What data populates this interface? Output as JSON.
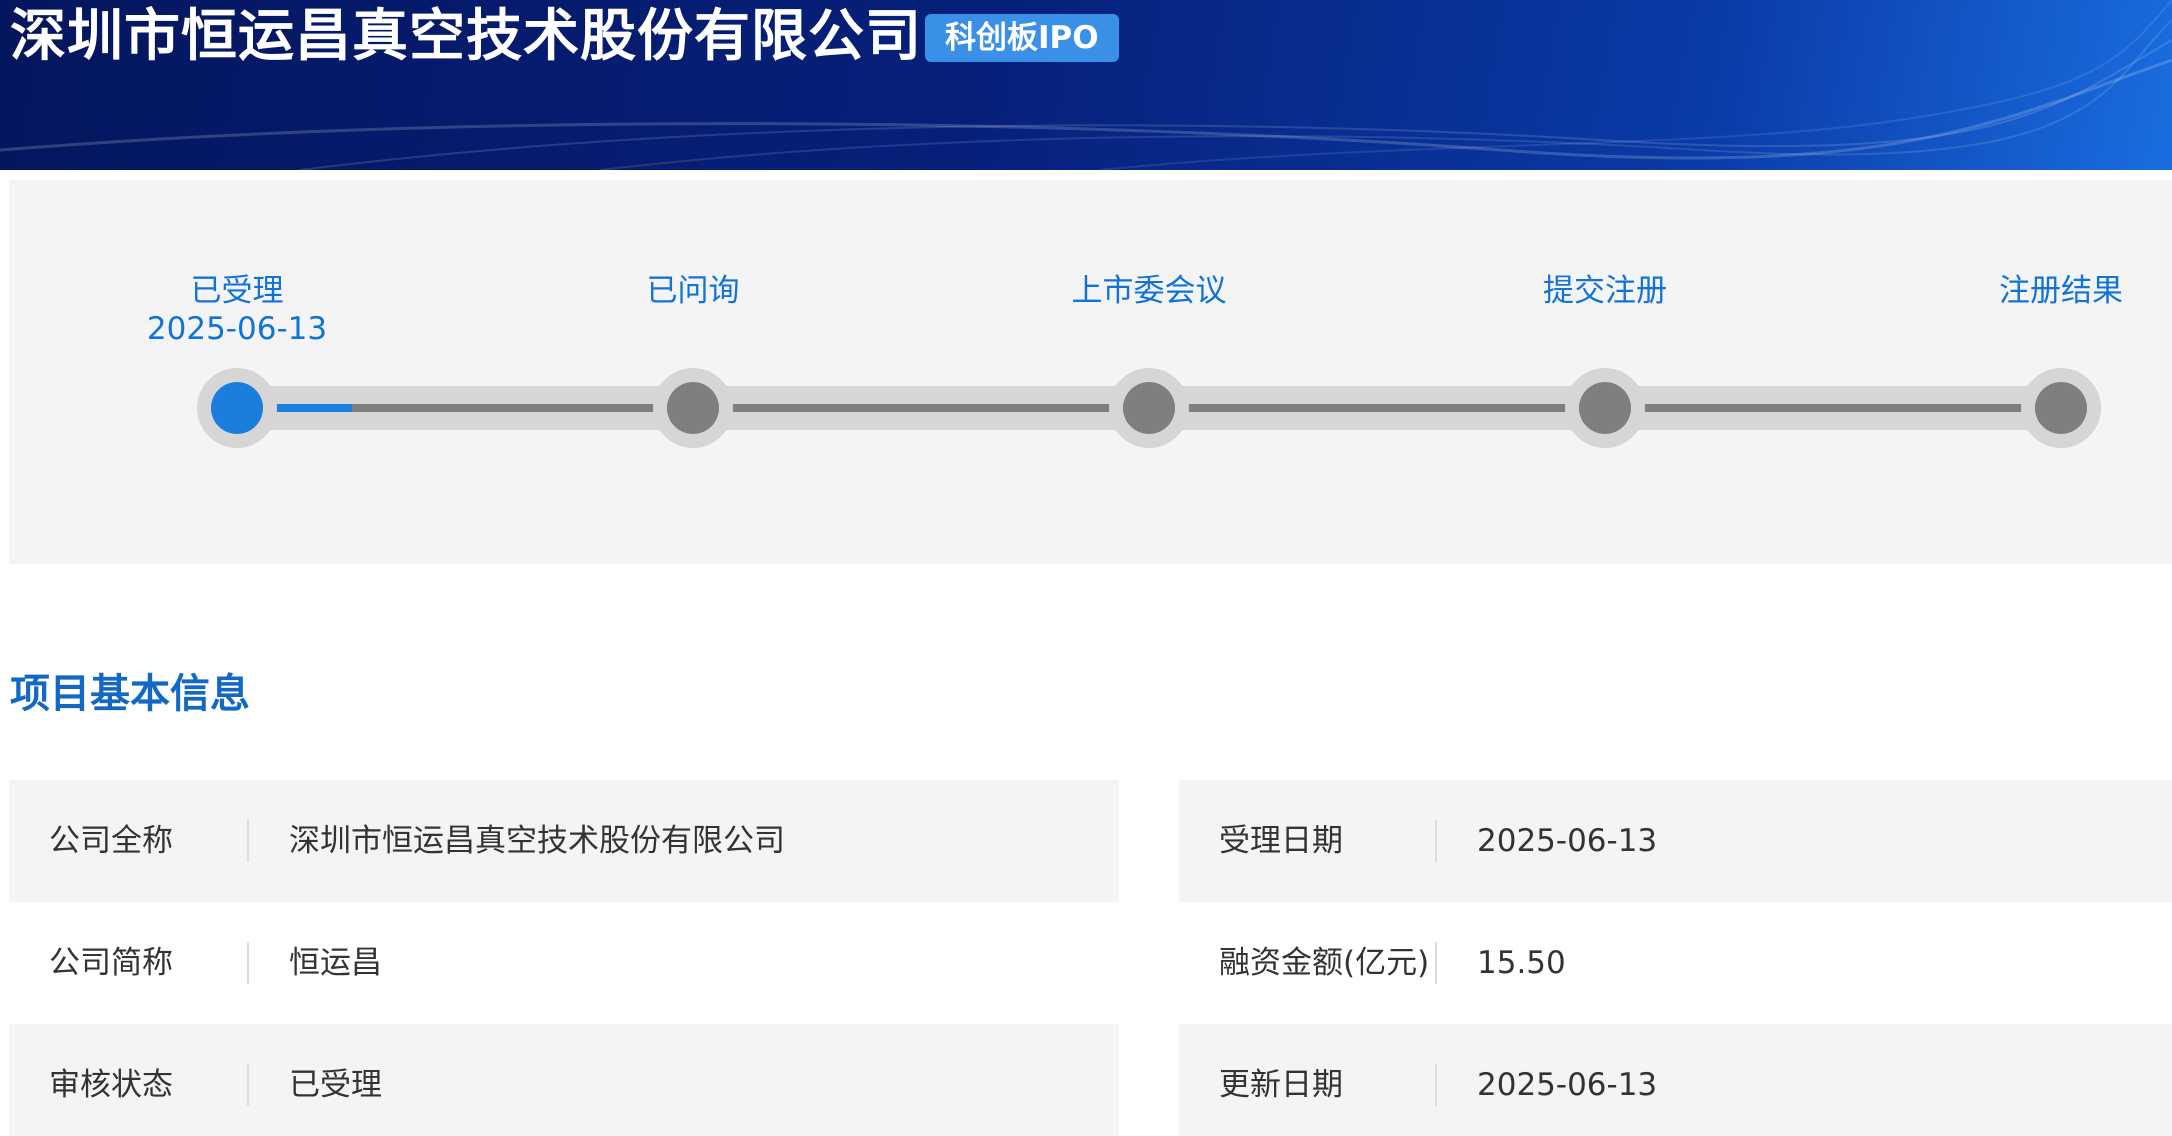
{
  "header": {
    "company_title": "深圳市恒运昌真空技术股份有限公司",
    "badge": "科创板IPO"
  },
  "progress": {
    "current_step": 0,
    "fill_fraction": 0.0625,
    "steps": [
      {
        "label": "已受理",
        "date": "2025-06-13",
        "active": true
      },
      {
        "label": "已问询",
        "date": "",
        "active": false
      },
      {
        "label": "上市委会议",
        "date": "",
        "active": false
      },
      {
        "label": "提交注册",
        "date": "",
        "active": false
      },
      {
        "label": "注册结果",
        "date": "",
        "active": false
      }
    ]
  },
  "section": {
    "title": "项目基本信息"
  },
  "info": {
    "left": [
      {
        "label": "公司全称",
        "value": "深圳市恒运昌真空技术股份有限公司"
      },
      {
        "label": "公司简称",
        "value": "恒运昌"
      },
      {
        "label": "审核状态",
        "value": "已受理"
      }
    ],
    "right": [
      {
        "label": "受理日期",
        "value": "2025-06-13"
      },
      {
        "label": "融资金额(亿元)",
        "value": "15.50"
      },
      {
        "label": "更新日期",
        "value": "2025-06-13"
      }
    ]
  },
  "colors": {
    "accent": "#1273d6",
    "active_node": "#1a7fdc",
    "inactive_node": "#7f7f7f",
    "banner_dark": "#04165e",
    "badge": "#3a8fe6"
  }
}
